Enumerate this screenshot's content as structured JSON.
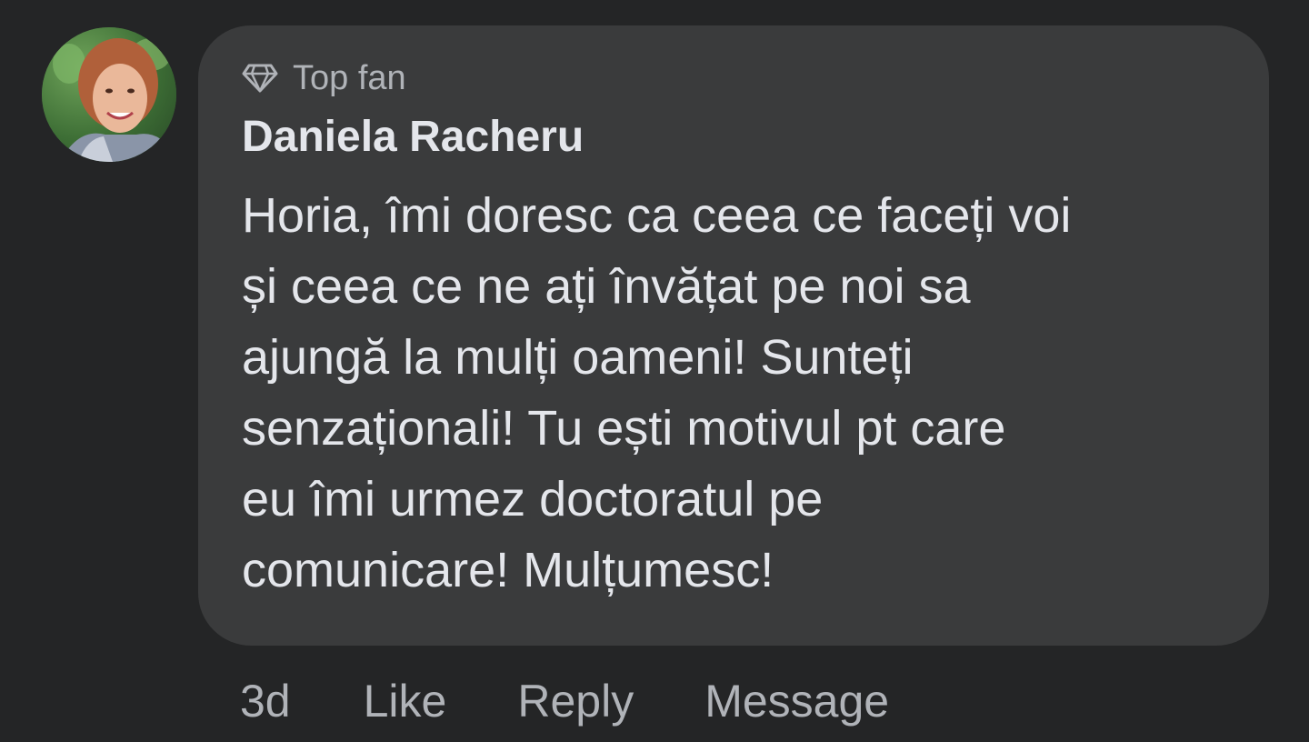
{
  "comment": {
    "badge": {
      "icon": "diamond-icon",
      "label": "Top fan"
    },
    "author": "Daniela Racheru",
    "text": "Horia, îmi doresc ca ceea ce faceți voi\nși ceea ce ne ați învățat pe noi sa\najungă la mulți oameni! Sunteți\nsenzaționali! Tu ești motivul pt care\neu îmi urmez doctoratul pe\ncomunicare! Mulțumesc!",
    "avatar_icon": "profile-photo"
  },
  "actions": {
    "timestamp": "3d",
    "like": "Like",
    "reply": "Reply",
    "message": "Message"
  },
  "colors": {
    "background": "#242526",
    "bubble": "#3a3b3c",
    "primary_text": "#e4e6eb",
    "secondary_text": "#b0b3b8"
  }
}
